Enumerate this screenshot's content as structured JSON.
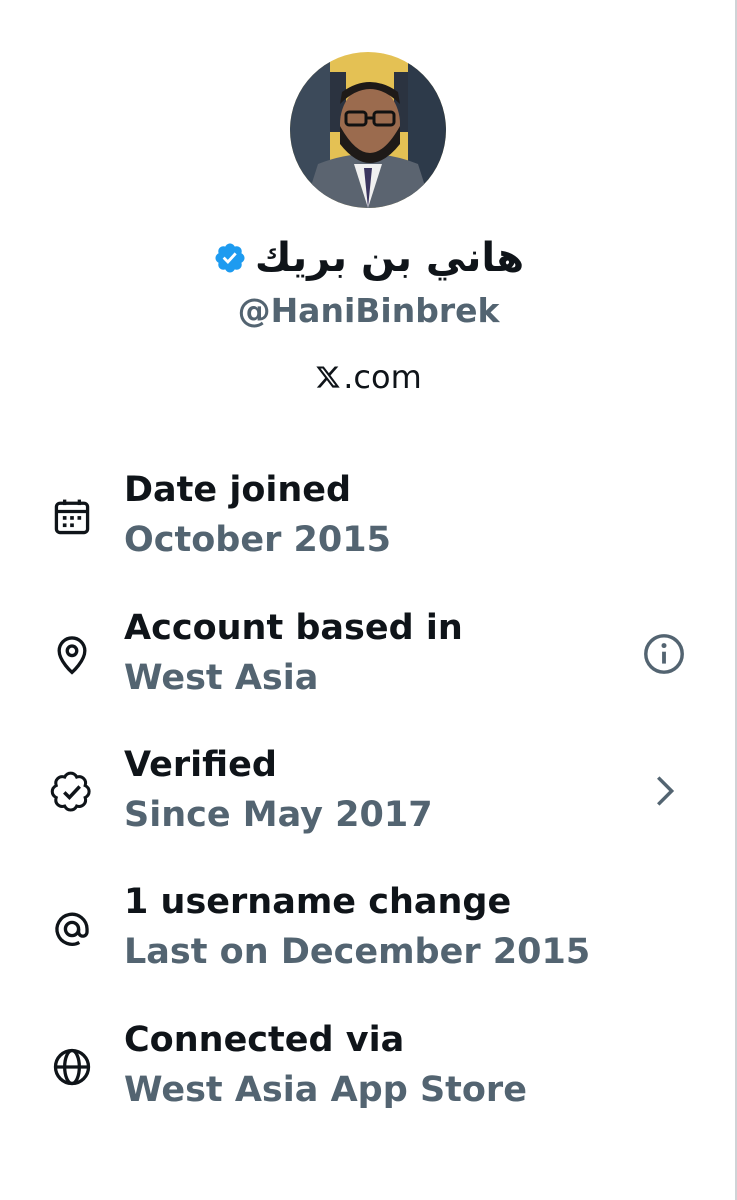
{
  "profile": {
    "display_name": "هاني بن بريك",
    "handle": "@HaniBinbrek",
    "platform": ".com",
    "verified_color": "#1d9bf0"
  },
  "details": [
    {
      "title": "Date joined",
      "value": "October 2015",
      "icon": "calendar-icon"
    },
    {
      "title": "Account based in",
      "value": "West Asia",
      "icon": "location-pin-icon",
      "trailing_icon": "info-icon"
    },
    {
      "title": "Verified",
      "value": "Since May 2017",
      "icon": "verified-badge-icon",
      "trailing_icon": "chevron-right-icon"
    },
    {
      "title": "1 username change",
      "value": "Last on December 2015",
      "icon": "at-sign-icon"
    },
    {
      "title": "Connected via",
      "value": "West Asia App Store",
      "icon": "globe-icon"
    }
  ],
  "colors": {
    "primary_text": "#0f1419",
    "secondary_text": "#536471",
    "accent": "#1d9bf0"
  }
}
